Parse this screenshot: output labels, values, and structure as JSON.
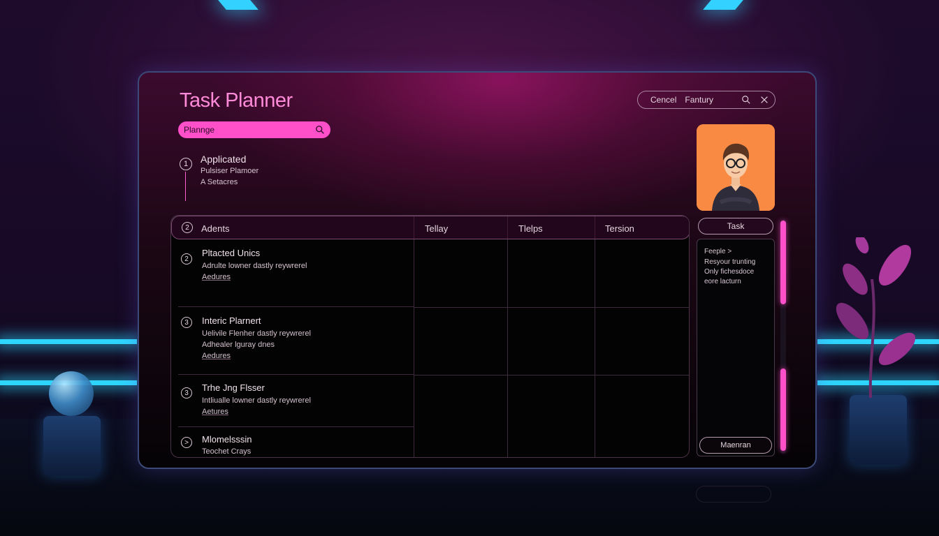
{
  "app": {
    "title": "Task Planner"
  },
  "search": {
    "value": "Plannge"
  },
  "top_actions": {
    "cancel": "Cencel",
    "second": "Fantury"
  },
  "applied": {
    "heading": "Applicated",
    "line1": "Pulsiser Plamoer",
    "line2": "A Setacres",
    "step": "1"
  },
  "table": {
    "headers": [
      {
        "icon": "2",
        "label": "Adents"
      },
      {
        "label": "Tellay"
      },
      {
        "label": "Tlelps"
      },
      {
        "label": "Tersion"
      }
    ],
    "rows": [
      {
        "icon": "2",
        "title": "Pltacted Unics",
        "lines": [
          "Adrulte lowner dastly reywrerel",
          "Aedures"
        ]
      },
      {
        "icon": "3",
        "title": "Interic Plarnert",
        "lines": [
          "Uelivile Flenher dastly reywrerel",
          "Adhealer lguray dnes",
          "Aedures"
        ]
      },
      {
        "icon": "3",
        "title": "Trhe Jng Flsser",
        "lines": [
          "Intliualle lowner dastly reywrerel",
          "Aetures"
        ]
      },
      {
        "icon": ">",
        "title": "Mlomelsssin",
        "lines": [
          "Teochet Crays"
        ]
      }
    ]
  },
  "side": {
    "task_button": "Task",
    "panel_lines": [
      "Feeple >",
      "Resyour trunting",
      "Only fichesdoce",
      "eore lacturn"
    ],
    "manage_button": "Maenran"
  },
  "colors": {
    "accent": "#ff4fc9",
    "title": "#ff8ad8",
    "neon": "#2ed6ff"
  }
}
